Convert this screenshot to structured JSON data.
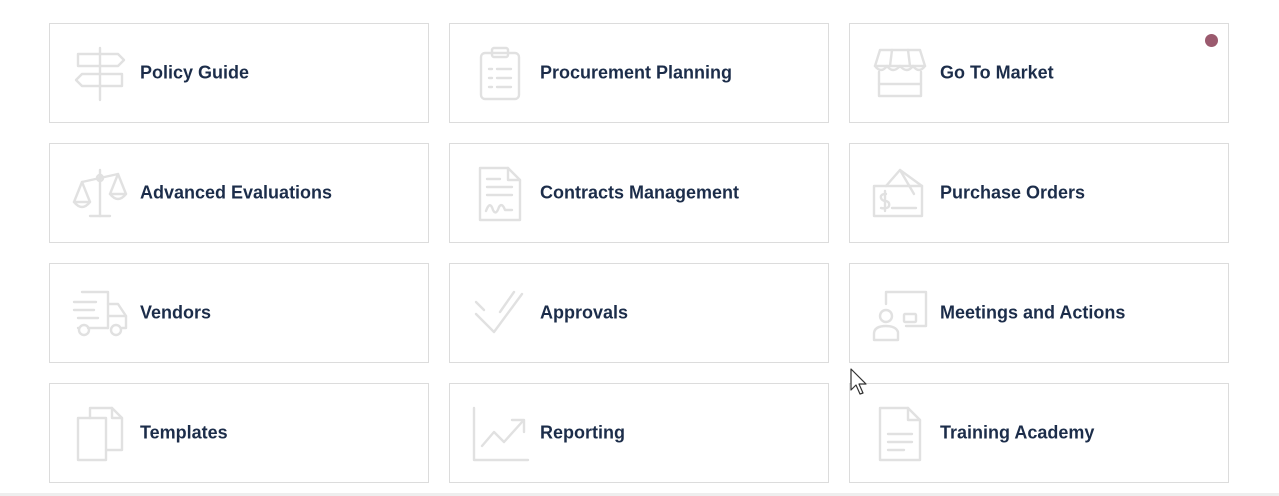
{
  "tiles": [
    {
      "label": "Policy Guide",
      "icon": "signpost-icon"
    },
    {
      "label": "Procurement Planning",
      "icon": "clipboard-list-icon"
    },
    {
      "label": "Go To Market",
      "icon": "storefront-icon",
      "notification": true
    },
    {
      "label": "Advanced Evaluations",
      "icon": "balance-scale-icon"
    },
    {
      "label": "Contracts Management",
      "icon": "signed-document-icon"
    },
    {
      "label": "Purchase Orders",
      "icon": "cheque-icon"
    },
    {
      "label": "Vendors",
      "icon": "delivery-truck-icon"
    },
    {
      "label": "Approvals",
      "icon": "checkmark-icon"
    },
    {
      "label": "Meetings and Actions",
      "icon": "presenter-board-icon"
    },
    {
      "label": "Templates",
      "icon": "copy-documents-icon"
    },
    {
      "label": "Reporting",
      "icon": "trending-chart-icon"
    },
    {
      "label": "Training Academy",
      "icon": "document-lines-icon"
    }
  ],
  "colors": {
    "label": "#1c2d4a",
    "icon": "#e1e1e1",
    "border": "#dcdcdc",
    "notification_dot": "#9b5a6e"
  }
}
